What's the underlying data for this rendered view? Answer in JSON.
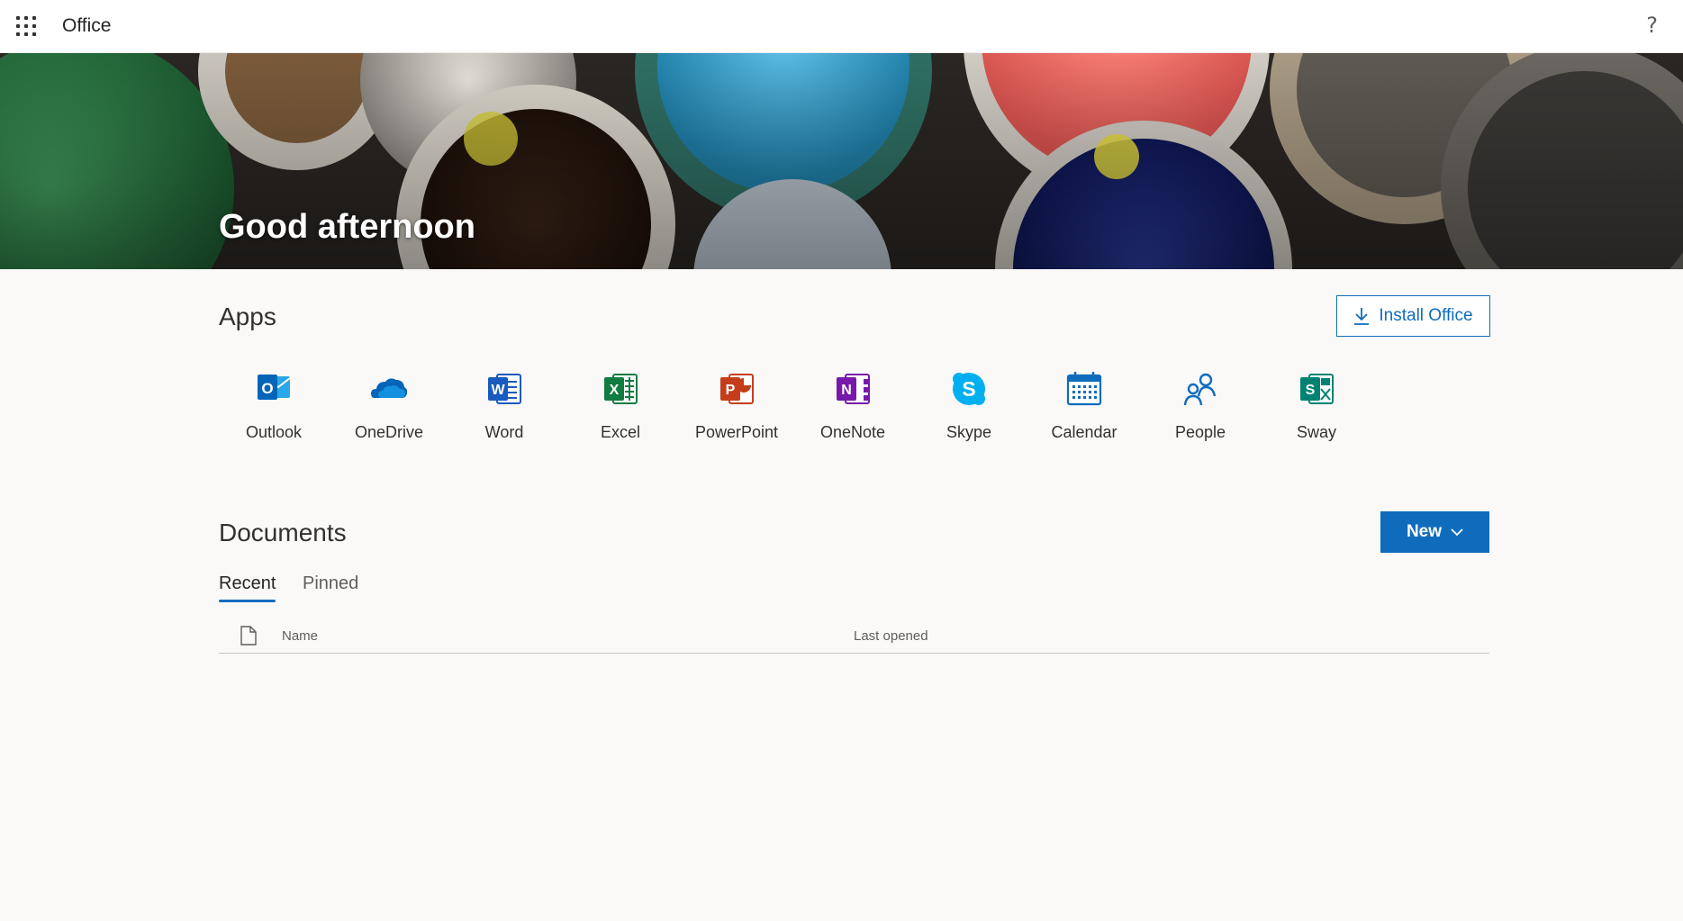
{
  "topbar": {
    "brand": "Office",
    "help_glyph": "?"
  },
  "hero": {
    "greeting": "Good afternoon"
  },
  "apps": {
    "title": "Apps",
    "install_label": "Install Office",
    "items": [
      {
        "label": "Outlook",
        "icon": "outlook-icon",
        "color": "#0364b8"
      },
      {
        "label": "OneDrive",
        "icon": "onedrive-icon",
        "color": "#0364b8"
      },
      {
        "label": "Word",
        "icon": "word-icon",
        "color": "#185abd"
      },
      {
        "label": "Excel",
        "icon": "excel-icon",
        "color": "#107c41"
      },
      {
        "label": "PowerPoint",
        "icon": "powerpoint-icon",
        "color": "#c43e1c"
      },
      {
        "label": "OneNote",
        "icon": "onenote-icon",
        "color": "#7719aa"
      },
      {
        "label": "Skype",
        "icon": "skype-icon",
        "color": "#00aff0"
      },
      {
        "label": "Calendar",
        "icon": "calendar-icon",
        "color": "#0f6cbd"
      },
      {
        "label": "People",
        "icon": "people-icon",
        "color": "#0f6cbd"
      },
      {
        "label": "Sway",
        "icon": "sway-icon",
        "color": "#008272"
      }
    ]
  },
  "documents": {
    "title": "Documents",
    "new_label": "New",
    "tabs": [
      {
        "label": "Recent",
        "active": true
      },
      {
        "label": "Pinned",
        "active": false
      }
    ],
    "columns": {
      "name": "Name",
      "last_opened": "Last opened"
    }
  },
  "colors": {
    "accent": "#0f6cbd",
    "background": "#faf9f8"
  }
}
